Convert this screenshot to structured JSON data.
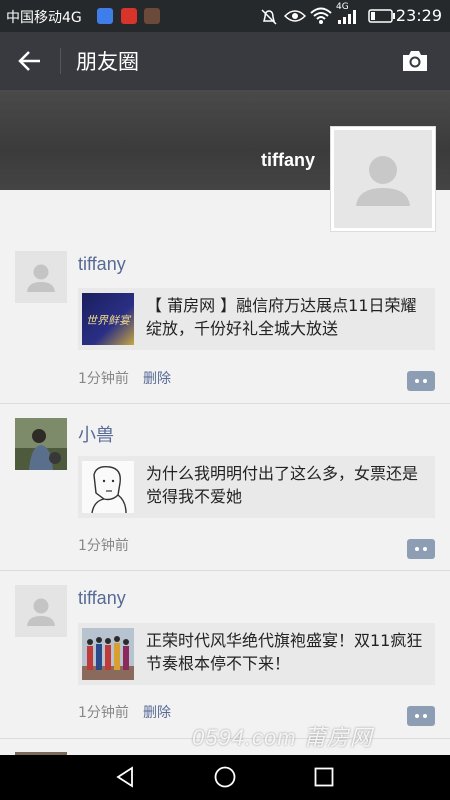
{
  "status_bar": {
    "carrier": "中国移动4G",
    "network_badge": "4G",
    "time": "23:29"
  },
  "nav": {
    "title": "朋友圈"
  },
  "cover": {
    "name": "tiffany"
  },
  "posts": [
    {
      "author": "tiffany",
      "share_text": "【 莆房网 】融信府万达展点11日荣耀绽放，千份好礼全城大放送",
      "thumb_text": "世界鲜宴",
      "time": "1分钟前",
      "delete_label": "删除"
    },
    {
      "author": "小兽",
      "share_text": "为什么我明明付出了这么多，女票还是觉得我不爱她",
      "time": "1分钟前"
    },
    {
      "author": "tiffany",
      "share_text": "正荣时代风华绝代旗袍盛宴！双11疯狂节奏根本停不下来！",
      "time": "1分钟前",
      "delete_label": "删除"
    }
  ],
  "watermark": "0594.com 莆房网",
  "colors": {
    "nav_bg": "#393a3f",
    "link": "#576b95",
    "page_bg": "#f2f2f2"
  }
}
